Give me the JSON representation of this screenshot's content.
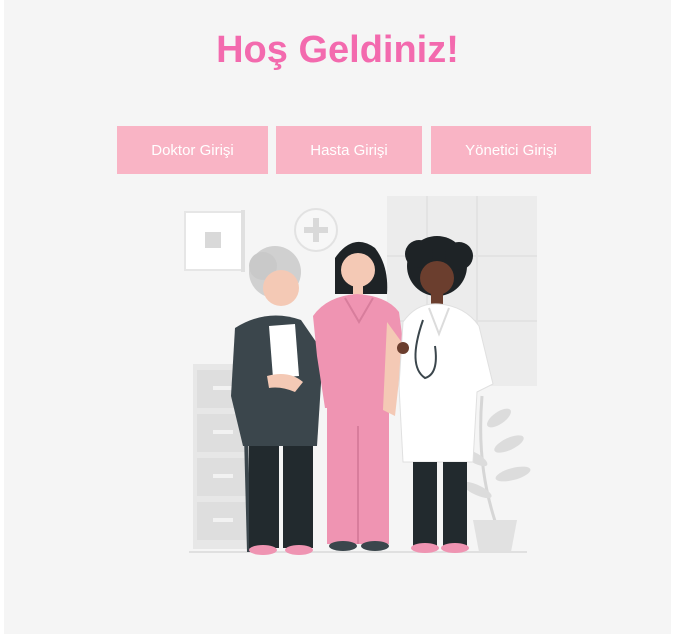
{
  "header": {
    "title": "Hoş Geldiniz!"
  },
  "login_buttons": {
    "doctor_label": "Doktor Girişi",
    "patient_label": "Hasta Girişi",
    "admin_label": "Yönetici Girişi"
  },
  "colors": {
    "accent": "#f36aae",
    "button_bg": "#f9b4c5",
    "scrubs_pink": "#ef94b2",
    "background": "#f5f5f5",
    "dark_clothing": "#3b464c"
  },
  "illustration": {
    "subject": "healthcare-team-illustration"
  }
}
